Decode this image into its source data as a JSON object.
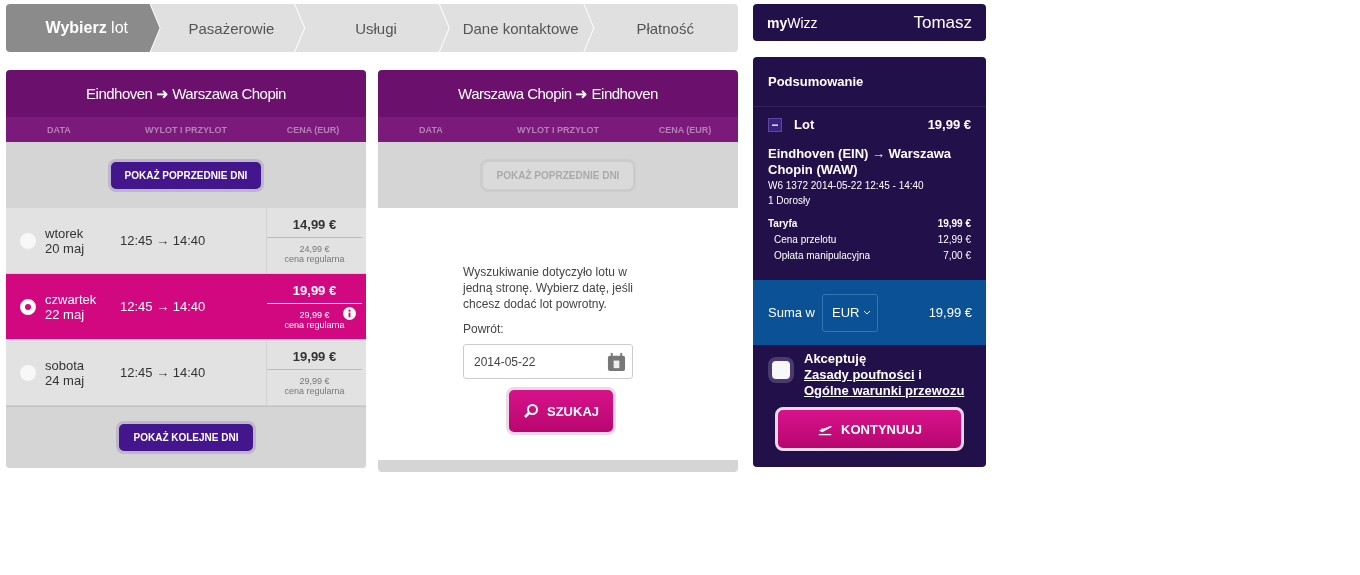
{
  "steps": [
    {
      "label": "**Wybierz** lot",
      "selected": true
    },
    {
      "label": "Pasażerowie",
      "selected": false
    },
    {
      "label": "Usługi",
      "selected": false
    },
    {
      "label": "Dane kontaktowe",
      "selected": false
    },
    {
      "label": "Płatność",
      "selected": false
    }
  ],
  "outbound": {
    "title": "Eindhoven ➜ Warszawa Chopin",
    "columns": [
      "DATA",
      "WYLOT I PRZYLOT",
      "CENA (EUR)"
    ],
    "prev_button": {
      "label": "POKAŻ POPRZEDNIE DNI",
      "disabled": false
    },
    "days": [
      {
        "weekday": "wtorek",
        "date": "20 maj",
        "times": "12:45 → 14:40",
        "price": "14,99 €",
        "regular_price": "24,99 €",
        "regular_label": "cena regularna",
        "selected": false,
        "info": false
      },
      {
        "weekday": "czwartek",
        "date": "22 maj",
        "times": "12:45 → 14:40",
        "price": "19,99 €",
        "regular_price": "29,99 €",
        "regular_label": "cena regularna",
        "selected": true,
        "info": true
      },
      {
        "weekday": "sobota",
        "date": "24 maj",
        "times": "12:45 → 14:40",
        "price": "19,99 €",
        "regular_price": "29,99 €",
        "regular_label": "cena regularna",
        "selected": false,
        "info": false
      }
    ],
    "next_button": {
      "label": "POKAŻ KOLEJNE DNI",
      "disabled": false
    }
  },
  "inbound": {
    "title": "Warszawa Chopin ➜ Eindhoven",
    "columns": [
      "DATA",
      "WYLOT I PRZYLOT",
      "CENA (EUR)"
    ],
    "prev_button": {
      "label": "POKAŻ POPRZEDNIE DNI",
      "disabled": true
    },
    "message": "Wyszukiwanie dotyczyło lotu w jedną stronę. Wybierz datę, jeśli chcesz dodać lot powrotny.",
    "return_label": "Powrót:",
    "return_date": "2014-05-22",
    "search_button": "SZUKAJ"
  },
  "mywizz": {
    "brand": "**my**Wizz",
    "user": "Tomasz"
  },
  "summary": {
    "title": "Podsumowanie",
    "section": {
      "label": "Lot",
      "expanded": true,
      "price": "19,99 €"
    },
    "route": "Eindhoven (EIN) → Warszawa Chopin (WAW)",
    "flight": "W6 1372  2014-05-22 12:45 - 14:40",
    "passengers": "1 Dorosły",
    "fares": [
      {
        "kind": "total",
        "label": "Taryfa",
        "value": "19,99 €"
      },
      {
        "kind": "sub",
        "label": "Cena przelotu",
        "value": "12,99 €"
      },
      {
        "kind": "sub",
        "label": "Opłata manipulacyjna",
        "value": "7,00 €"
      }
    ],
    "total": {
      "label": "Suma w",
      "currency": "EUR",
      "amount": "19,99 €"
    },
    "accepted": false,
    "terms": [
      {
        "kind": "text",
        "text": "Akceptuję"
      },
      {
        "kind": "link",
        "text": "Zasady poufności"
      },
      {
        "kind": "text",
        "text": "i"
      },
      {
        "kind": "link",
        "text": "Ogólne warunki przewozu"
      }
    ],
    "continue_button": "KONTYNUUJ"
  }
}
